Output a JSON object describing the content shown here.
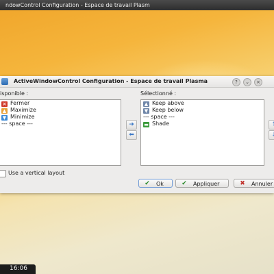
{
  "background_window": {
    "title": "ndowControl Configuration - Espace de travail Plasm"
  },
  "dialog": {
    "title": "ActiveWindowControl Configuration - Espace de travail Plasma",
    "titlebar_buttons": [
      "help-icon",
      "minimize-icon",
      "close-icon"
    ],
    "available_label": "isponible :",
    "selected_label": "Sélectionné :",
    "available_items": [
      {
        "label": "Fermer",
        "icon": "close-x-icon",
        "color": "#d03a2a"
      },
      {
        "label": "Maximize",
        "icon": "maximize-icon",
        "color": "#e8a23a"
      },
      {
        "label": "Minimize",
        "icon": "minimize-icon",
        "color": "#3d8bd6"
      },
      {
        "label": "--- space ---",
        "icon": "",
        "color": ""
      }
    ],
    "selected_items": [
      {
        "label": "Keep above",
        "icon": "keep-above-icon",
        "color": "#6f86a8"
      },
      {
        "label": "Keep below",
        "icon": "keep-below-icon",
        "color": "#6f86a8"
      },
      {
        "label": "--- space ---",
        "icon": "",
        "color": ""
      },
      {
        "label": "Shade",
        "icon": "shade-icon",
        "color": "#3a9a3a"
      }
    ],
    "vertical_layout_label": "Use a vertical layout",
    "vertical_layout_checked": false,
    "ok_label": "Ok",
    "apply_label": "Appliquer",
    "cancel_label": "Annuler",
    "colors": {
      "accent": "#3d79c6",
      "ok_check": "#2a8a2a",
      "cancel_x": "#c0302a"
    }
  },
  "taskbar": {
    "clock": "16:06"
  }
}
